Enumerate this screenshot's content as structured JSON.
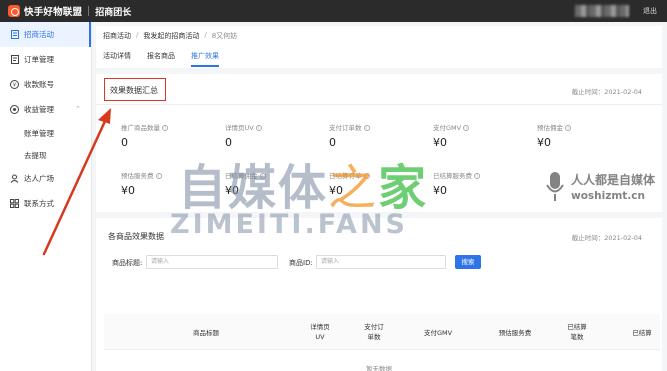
{
  "topbar": {
    "brand": "快手好物联盟",
    "sub": "招商团长",
    "logout": "退出"
  },
  "sidebar": {
    "items": [
      {
        "label": "招商活动",
        "icon": "document-icon",
        "active": true
      },
      {
        "label": "订单管理",
        "icon": "orders-icon"
      },
      {
        "label": "收款账号",
        "icon": "account-icon"
      },
      {
        "label": "收益管理",
        "icon": "revenue-icon"
      },
      {
        "label": "账单管理",
        "sub": true
      },
      {
        "label": "去提现",
        "sub": true
      },
      {
        "label": "达人广场",
        "icon": "people-icon"
      },
      {
        "label": "联系方式",
        "icon": "contact-icon"
      }
    ]
  },
  "breadcrumb": {
    "a": "招商活动",
    "b": "我发起的招商活动",
    "c": "8又何妨"
  },
  "tabs": [
    "活动详情",
    "报名商品",
    "推广效果"
  ],
  "summary": {
    "title": "效果数据汇总",
    "time": "截止时间：2021-02-04",
    "metrics": [
      {
        "label": "推广商品数量",
        "value": "0"
      },
      {
        "label": "详情页UV",
        "value": "0"
      },
      {
        "label": "支付订单数",
        "value": "0"
      },
      {
        "label": "支付GMV",
        "value": "¥0"
      },
      {
        "label": "预估佣金",
        "value": "¥0"
      },
      {
        "label": "预估服务费",
        "value": "¥0"
      },
      {
        "label": "已结算佣金",
        "value": "¥0"
      },
      {
        "label": "已结算订单",
        "value": "¥0"
      },
      {
        "label": "已结算服务费",
        "value": "¥0"
      }
    ]
  },
  "products": {
    "title": "各商品效果数据",
    "time": "截止时间：2021-02-04",
    "filter": {
      "title_label": "商品标题:",
      "title_placeholder": "请输入",
      "id_label": "商品ID:",
      "id_placeholder": "请输入",
      "search": "搜索"
    },
    "columns": [
      "商品标题",
      "详情页\nUV",
      "支付订\n单数",
      "支付GMV",
      "预估服务费",
      "已结算\n笔数",
      "已结算"
    ],
    "empty": "暂无数据"
  },
  "watermark": {
    "cn_a": "自媒体",
    "cn_b": "之",
    "cn_c": "家",
    "en": "ZIMEITI.FANS",
    "right_cn": "人人都是自媒体",
    "right_en": "woshizmt.cn"
  },
  "colors": {
    "accent": "#2d74e8",
    "topbar": "#2b2b2b",
    "highlight": "#d9381e"
  }
}
